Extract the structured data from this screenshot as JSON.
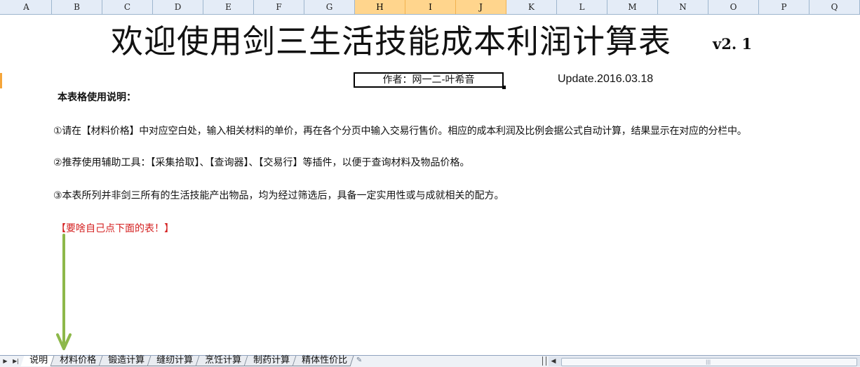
{
  "columns": [
    "A",
    "B",
    "C",
    "D",
    "E",
    "F",
    "G",
    "H",
    "I",
    "J",
    "K",
    "L",
    "M",
    "N",
    "O",
    "P",
    "Q"
  ],
  "selected_columns": [
    "H",
    "I",
    "J"
  ],
  "title": "欢迎使用剑三生活技能成本利润计算表",
  "version": "v2. 1",
  "author": "作者：网一二-叶希音",
  "update": "Update.2016.03.18",
  "usage_title": "本表格使用说明：",
  "paragraphs": [
    "①请在【材料价格】中对应空白处，输入相关材料的单价，再在各个分页中输入交易行售价。相应的成本利润及比例会据公式自动计算，结果显示在对应的分栏中。",
    "②推荐使用辅助工具：【采集拾取】、【查询器】、【交易行】等插件，以便于查询材料及物品价格。",
    "③本表所列并非剑三所有的生活技能产出物品，均为经过筛选后，具备一定实用性或与成就相关的配方。"
  ],
  "red_note": "【要啥自己点下面的表！】",
  "colors": {
    "red_note": "#d42020",
    "arrow": "#8db84a",
    "selected_header": "#ffd58d"
  },
  "sheet_tabs": [
    "说明",
    "材料价格",
    "锻造计算",
    "缝纫计算",
    "烹饪计算",
    "制药计算",
    "精体性价比"
  ],
  "active_tab": "说明",
  "icons": {
    "first_sheet": "nav-first-icon",
    "last_sheet": "nav-last-icon",
    "new_sheet": "new-sheet-icon",
    "scroll_left": "scroll-left-icon"
  }
}
